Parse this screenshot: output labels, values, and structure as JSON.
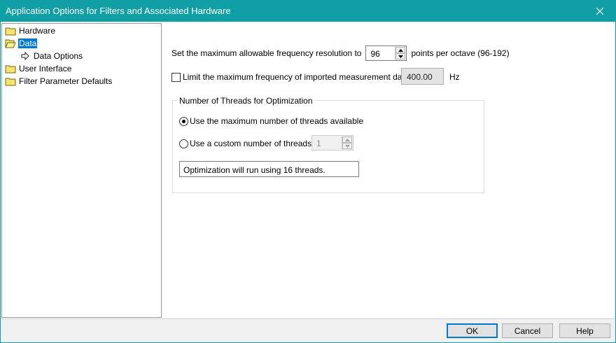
{
  "window": {
    "title": "Application Options for Filters and Associated Hardware",
    "close_icon": "close-icon"
  },
  "tree": {
    "items": [
      {
        "label": "Hardware",
        "icon": "folder-closed-icon"
      },
      {
        "label": "Data",
        "icon": "folder-open-icon",
        "selected": true
      },
      {
        "label": "Data Options",
        "icon": "arrow-right-icon"
      },
      {
        "label": "User Interface",
        "icon": "folder-closed-icon"
      },
      {
        "label": "Filter Parameter Defaults",
        "icon": "folder-closed-icon"
      }
    ]
  },
  "data_options": {
    "resolution_label": "Set the maximum allowable frequency resolution to",
    "resolution_value": "96",
    "resolution_suffix": "points per octave (96-192)",
    "limit_checkbox_label": "Limit the maximum frequency of imported measurement data to",
    "limit_checked": false,
    "limit_value": "400.00",
    "limit_unit": "Hz",
    "threads_group_title": "Number of Threads for Optimization",
    "radio_max_label": "Use the maximum number of threads available",
    "radio_custom_label": "Use a custom number of threads:",
    "custom_threads_value": "1",
    "status_text": "Optimization will run using 16 threads."
  },
  "footer": {
    "ok_label": "OK",
    "cancel_label": "Cancel",
    "help_label": "Help"
  },
  "colors": {
    "titlebar": "#0f9fa4",
    "selection": "#0078d7"
  }
}
